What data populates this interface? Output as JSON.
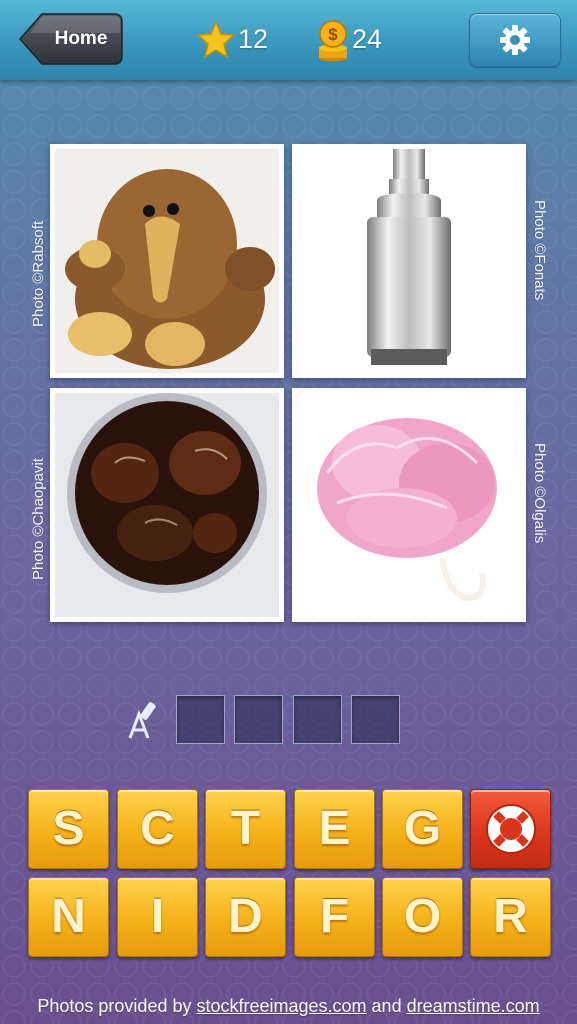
{
  "header": {
    "home_label": "Home",
    "stars": "12",
    "coins": "24",
    "icons": {
      "star": "star-icon",
      "coin": "coin-stack-icon",
      "settings": "gear-icon"
    }
  },
  "photos": [
    {
      "subject": "plush kiwi bird toy",
      "credit": "Photo ©Rabsoft"
    },
    {
      "subject": "chrome soap dispenser",
      "credit": "Photo ©Fonats"
    },
    {
      "subject": "glass of cola with ice",
      "credit": "Photo ©Chaopavit"
    },
    {
      "subject": "pink bath sponge",
      "credit": "Photo ©Olgalis"
    }
  ],
  "answer": {
    "slots": [
      "",
      "",
      "",
      ""
    ],
    "hint_icon": "reveal-letter-icon"
  },
  "letters": {
    "row1": [
      "S",
      "C",
      "T",
      "E",
      "G"
    ],
    "row2": [
      "N",
      "I",
      "D",
      "F",
      "O",
      "R"
    ],
    "help_icon": "lifebuoy-icon"
  },
  "footer": {
    "prefix": "Photos provided by ",
    "link1": "stockfreeimages.com",
    "middle": " and ",
    "link2": "dreamstime.com"
  },
  "colors": {
    "tile": "#f5b21a",
    "help_tile": "#d8361c",
    "topbar": "#3b97bd"
  }
}
